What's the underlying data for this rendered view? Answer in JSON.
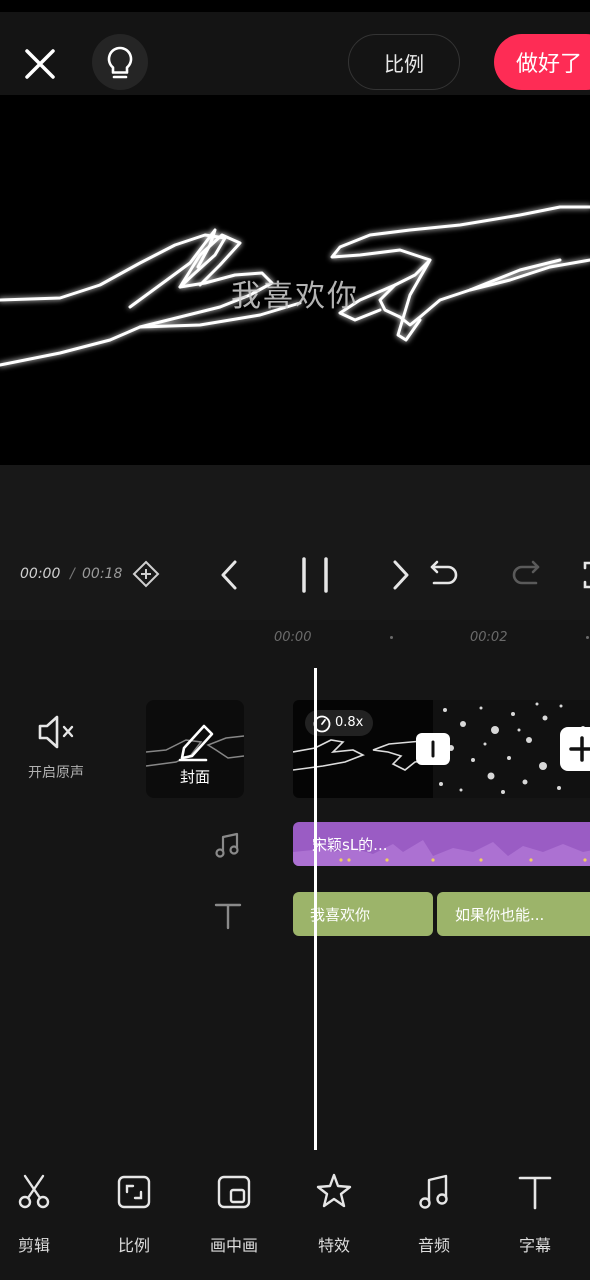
{
  "header": {
    "ratio_label": "比例",
    "done_label": "做好了"
  },
  "preview": {
    "caption": "我喜欢你"
  },
  "playback": {
    "current_time": "00:00",
    "separator": "/",
    "total_time": "00:18"
  },
  "ruler": {
    "marks": [
      "00:00",
      "00:02"
    ]
  },
  "track_controls": {
    "mute_label": "开启原声",
    "cover_label": "封面"
  },
  "video": {
    "speed": "0.8x"
  },
  "audio": {
    "label": "宋颖sL的..."
  },
  "text_clips": [
    "我喜欢你",
    "如果你也能..."
  ],
  "toolbar": {
    "items": [
      "剪辑",
      "比例",
      "画中画",
      "特效",
      "音频",
      "字幕"
    ]
  },
  "colors": {
    "accent": "#fe2c55",
    "audio_track": "#9a5cc4",
    "text_track": "#9cb46a",
    "background": "#151515"
  }
}
